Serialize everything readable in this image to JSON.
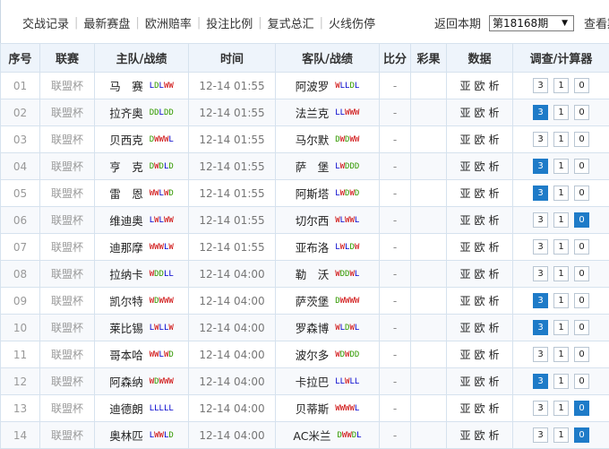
{
  "nav": {
    "links": [
      "交战记录",
      "最新赛盘",
      "欧洲赔率",
      "投注比例",
      "复式总汇",
      "火线伤停"
    ],
    "period_label": "返回本期",
    "period_value": "第18168期",
    "view_label": "查看期"
  },
  "table": {
    "headers": [
      "序号",
      "联赛",
      "主队/战绩",
      "时间",
      "客队/战绩",
      "比分",
      "彩果",
      "数据",
      "调查/计算器"
    ],
    "data_links": [
      "亚",
      "欧",
      "析"
    ],
    "rows": [
      {
        "no": "01",
        "league": "联盟杯",
        "home": "马　赛",
        "home_form": "LDLWW",
        "time": "12-14 01:55",
        "away": "阿波罗",
        "away_form": "WLLDL",
        "score": "-",
        "result": "",
        "calc": [
          "3",
          "1",
          "0"
        ],
        "active": []
      },
      {
        "no": "02",
        "league": "联盟杯",
        "home": "拉齐奥",
        "home_form": "DDLDD",
        "time": "12-14 01:55",
        "away": "法兰克",
        "away_form": "LLWWW",
        "score": "-",
        "result": "",
        "calc": [
          "3",
          "1",
          "0"
        ],
        "active": [
          0
        ]
      },
      {
        "no": "03",
        "league": "联盟杯",
        "home": "贝西克",
        "home_form": "DWWWL",
        "time": "12-14 01:55",
        "away": "马尔默",
        "away_form": "DWDWW",
        "score": "-",
        "result": "",
        "calc": [
          "3",
          "1",
          "0"
        ],
        "active": []
      },
      {
        "no": "04",
        "league": "联盟杯",
        "home": "亨　克",
        "home_form": "DWDLD",
        "time": "12-14 01:55",
        "away": "萨　堡",
        "away_form": "LWDDD",
        "score": "-",
        "result": "",
        "calc": [
          "3",
          "1",
          "0"
        ],
        "active": [
          0
        ]
      },
      {
        "no": "05",
        "league": "联盟杯",
        "home": "雷　恩",
        "home_form": "WWLWD",
        "time": "12-14 01:55",
        "away": "阿斯塔",
        "away_form": "LWDWD",
        "score": "-",
        "result": "",
        "calc": [
          "3",
          "1",
          "0"
        ],
        "active": [
          0
        ]
      },
      {
        "no": "06",
        "league": "联盟杯",
        "home": "维迪奥",
        "home_form": "LWLWW",
        "time": "12-14 01:55",
        "away": "切尔西",
        "away_form": "WLWWL",
        "score": "-",
        "result": "",
        "calc": [
          "3",
          "1",
          "0"
        ],
        "active": [
          2
        ]
      },
      {
        "no": "07",
        "league": "联盟杯",
        "home": "迪那摩",
        "home_form": "WWWLW",
        "time": "12-14 01:55",
        "away": "亚布洛",
        "away_form": "LWLDW",
        "score": "-",
        "result": "",
        "calc": [
          "3",
          "1",
          "0"
        ],
        "active": []
      },
      {
        "no": "08",
        "league": "联盟杯",
        "home": "拉纳卡",
        "home_form": "WDDLL",
        "time": "12-14 04:00",
        "away": "勒　沃",
        "away_form": "WDDWL",
        "score": "-",
        "result": "",
        "calc": [
          "3",
          "1",
          "0"
        ],
        "active": []
      },
      {
        "no": "09",
        "league": "联盟杯",
        "home": "凯尔特",
        "home_form": "WDWWW",
        "time": "12-14 04:00",
        "away": "萨茨堡",
        "away_form": "DWWWW",
        "score": "-",
        "result": "",
        "calc": [
          "3",
          "1",
          "0"
        ],
        "active": [
          0
        ]
      },
      {
        "no": "10",
        "league": "联盟杯",
        "home": "莱比锡",
        "home_form": "LWLLW",
        "time": "12-14 04:00",
        "away": "罗森博",
        "away_form": "WLDWL",
        "score": "-",
        "result": "",
        "calc": [
          "3",
          "1",
          "0"
        ],
        "active": [
          0
        ]
      },
      {
        "no": "11",
        "league": "联盟杯",
        "home": "哥本哈",
        "home_form": "WWLWD",
        "time": "12-14 04:00",
        "away": "波尔多",
        "away_form": "WDWDD",
        "score": "-",
        "result": "",
        "calc": [
          "3",
          "1",
          "0"
        ],
        "active": []
      },
      {
        "no": "12",
        "league": "联盟杯",
        "home": "阿森纳",
        "home_form": "WDWWW",
        "time": "12-14 04:00",
        "away": "卡拉巴",
        "away_form": "LLWLL",
        "score": "-",
        "result": "",
        "calc": [
          "3",
          "1",
          "0"
        ],
        "active": [
          0
        ]
      },
      {
        "no": "13",
        "league": "联盟杯",
        "home": "迪德朗",
        "home_form": "LLLLL",
        "time": "12-14 04:00",
        "away": "贝蒂斯",
        "away_form": "WWWWL",
        "score": "-",
        "result": "",
        "calc": [
          "3",
          "1",
          "0"
        ],
        "active": [
          2
        ]
      },
      {
        "no": "14",
        "league": "联盟杯",
        "home": "奥林匹",
        "home_form": "LWWLD",
        "time": "12-14 04:00",
        "away": "AC米兰",
        "away_form": "DWWDL",
        "score": "-",
        "result": "",
        "calc": [
          "3",
          "1",
          "0"
        ],
        "active": [
          2
        ]
      }
    ]
  },
  "colors": {
    "accent_blue": "#1e7bc8",
    "form_win": "#cc0000",
    "form_draw": "#339900",
    "form_loss": "#0000cc"
  }
}
